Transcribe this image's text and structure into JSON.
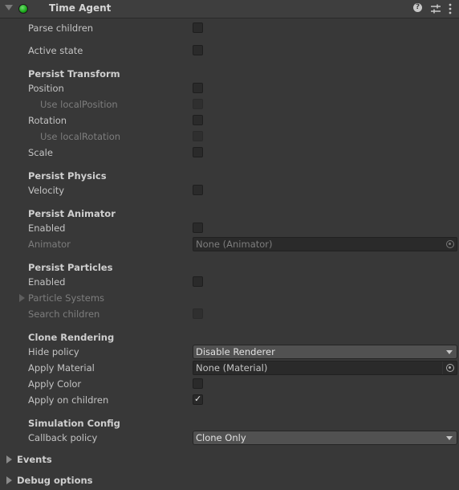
{
  "header": {
    "title": "Time Agent",
    "status_color": "#22b022",
    "icons": [
      "help-icon",
      "presets-icon",
      "context-menu-icon"
    ]
  },
  "general": {
    "parse_children": {
      "label": "Parse children",
      "checked": false
    },
    "active_state": {
      "label": "Active state",
      "checked": false
    }
  },
  "persist_transform": {
    "heading": "Persist Transform",
    "position": {
      "label": "Position",
      "checked": false
    },
    "use_local_position": {
      "label": "Use localPosition",
      "checked": false,
      "disabled": true
    },
    "rotation": {
      "label": "Rotation",
      "checked": false
    },
    "use_local_rotation": {
      "label": "Use localRotation",
      "checked": false,
      "disabled": true
    },
    "scale": {
      "label": "Scale",
      "checked": false
    }
  },
  "persist_physics": {
    "heading": "Persist Physics",
    "velocity": {
      "label": "Velocity",
      "checked": false
    }
  },
  "persist_animator": {
    "heading": "Persist Animator",
    "enabled": {
      "label": "Enabled",
      "checked": false
    },
    "animator": {
      "label": "Animator",
      "value": "None (Animator)",
      "disabled": true
    }
  },
  "persist_particles": {
    "heading": "Persist Particles",
    "enabled": {
      "label": "Enabled",
      "checked": false
    },
    "particle_systems": {
      "label": "Particle Systems",
      "disabled": true
    },
    "search_children": {
      "label": "Search children",
      "checked": false,
      "disabled": true
    }
  },
  "clone_rendering": {
    "heading": "Clone Rendering",
    "hide_policy": {
      "label": "Hide policy",
      "value": "Disable Renderer"
    },
    "apply_material": {
      "label": "Apply Material",
      "value": "None (Material)"
    },
    "apply_color": {
      "label": "Apply Color",
      "checked": false
    },
    "apply_on_children": {
      "label": "Apply on children",
      "checked": true,
      "check_glyph": "✓"
    }
  },
  "simulation_config": {
    "heading": "Simulation Config",
    "callback_policy": {
      "label": "Callback policy",
      "value": "Clone Only"
    }
  },
  "foldouts": {
    "events": "Events",
    "debug_options": "Debug options"
  }
}
